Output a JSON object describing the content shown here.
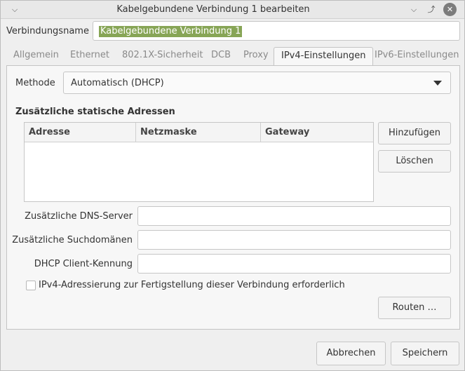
{
  "window": {
    "title": "Kabelgebundene Verbindung 1 bearbeiten",
    "menu_icon": "chevron-down-icon",
    "minimize_icon": "minimize-icon",
    "maximize_icon": "maximize-icon",
    "close_icon": "close-icon"
  },
  "connection": {
    "name_label": "Verbindungsname",
    "name_value": "Kabelgebundene Verbindung 1"
  },
  "tabs": [
    {
      "label": "Allgemein",
      "active": false
    },
    {
      "label": "Ethernet",
      "active": false
    },
    {
      "label": "802.1X-Sicherheit",
      "active": false
    },
    {
      "label": "DCB",
      "active": false
    },
    {
      "label": "Proxy",
      "active": false
    },
    {
      "label": "IPv4-Einstellungen",
      "active": true
    },
    {
      "label": "IPv6-Einstellungen",
      "active": false
    }
  ],
  "ipv4": {
    "method_label": "Methode",
    "method_value": "Automatisch (DHCP)",
    "static_title": "Zusätzliche statische Adressen",
    "columns": [
      "Adresse",
      "Netzmaske",
      "Gateway"
    ],
    "rows": [],
    "add_button": "Hinzufügen",
    "delete_button": "Löschen",
    "dns_label": "Zusätzliche DNS-Server",
    "dns_value": "",
    "search_label": "Zusätzliche Suchdomänen",
    "search_value": "",
    "dhcp_label": "DHCP Client-Kennung",
    "dhcp_value": "",
    "require_label": "IPv4-Adressierung zur Fertigstellung dieser Verbindung erforderlich",
    "require_checked": false,
    "routes_button": "Routen …"
  },
  "footer": {
    "cancel_button": "Abbrechen",
    "save_button": "Speichern"
  },
  "colors": {
    "selection": "#87a556",
    "close_button": "#7c7c7c"
  }
}
